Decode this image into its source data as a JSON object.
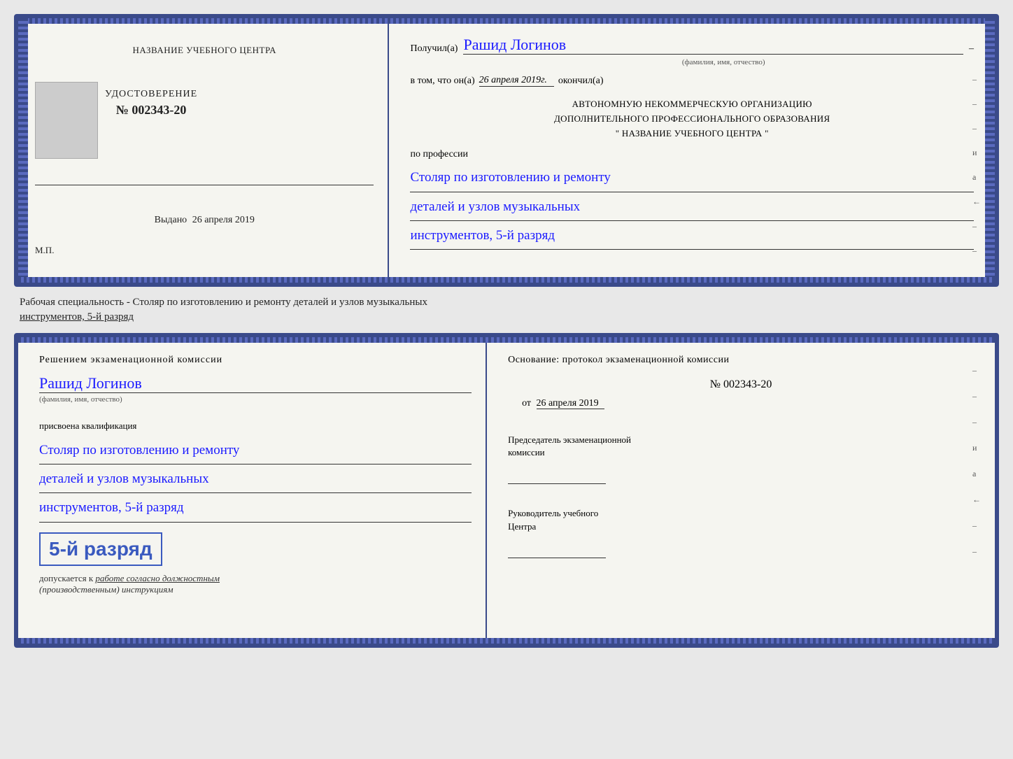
{
  "top_card": {
    "left": {
      "org_title": "НАЗВАНИЕ УЧЕБНОГО ЦЕНТРА",
      "cert_title": "УДОСТОВЕРЕНИЕ",
      "cert_number": "№ 002343-20",
      "issued_label": "Выдано",
      "issued_date": "26 апреля 2019",
      "mp_label": "М.П."
    },
    "right": {
      "received_label": "Получил(а)",
      "recipient_name": "Рашид Логинов",
      "fio_hint": "(фамилия, имя, отчество)",
      "date_intro": "в том, что он(а)",
      "date_value": "26 апреля 2019г.",
      "finished_label": "окончил(а)",
      "org_line1": "АВТОНОМНУЮ НЕКОММЕРЧЕСКУЮ ОРГАНИЗАЦИЮ",
      "org_line2": "ДОПОЛНИТЕЛЬНОГО ПРОФЕССИОНАЛЬНОГО ОБРАЗОВАНИЯ",
      "org_line3": "\"  НАЗВАНИЕ УЧЕБНОГО ЦЕНТРА  \"",
      "profession_label": "по профессии",
      "profession_line1": "Столяр по изготовлению и ремонту",
      "profession_line2": "деталей и узлов музыкальных",
      "profession_line3": "инструментов, 5-й разряд",
      "side_marks": [
        "-",
        "-",
        "-",
        "и",
        "а",
        "←",
        "-",
        "-",
        "-",
        "-"
      ]
    }
  },
  "specialty_label": "Рабочая специальность - Столяр по изготовлению и ремонту деталей и узлов музыкальных",
  "specialty_label2": "инструментов, 5-й разряд",
  "bottom_card": {
    "left": {
      "decision_title": "Решением  экзаменационной  комиссии",
      "person_name": "Рашид Логинов",
      "fio_hint": "(фамилия, имя, отчество)",
      "assigned_text": "присвоена квалификация",
      "profession_line1": "Столяр по изготовлению и ремонту",
      "profession_line2": "деталей и узлов музыкальных",
      "profession_line3": "инструментов, 5-й разряд",
      "rank_text": "5-й разряд",
      "допуск_label": "допускается к",
      "допуск_value": "работе согласно должностным",
      "допуск_value2": "(производственным) инструкциям"
    },
    "right": {
      "basis_text": "Основание:  протокол  экзаменационной  комиссии",
      "protocol_number": "№  002343-20",
      "date_from_label": "от",
      "date_from_value": "26 апреля 2019",
      "chairman_title": "Председатель экзаменационной",
      "chairman_title2": "комиссии",
      "director_title": "Руководитель учебного",
      "director_title2": "Центра",
      "side_marks": [
        "-",
        "-",
        "-",
        "и",
        "а",
        "←",
        "-",
        "-",
        "-",
        "-"
      ]
    }
  }
}
